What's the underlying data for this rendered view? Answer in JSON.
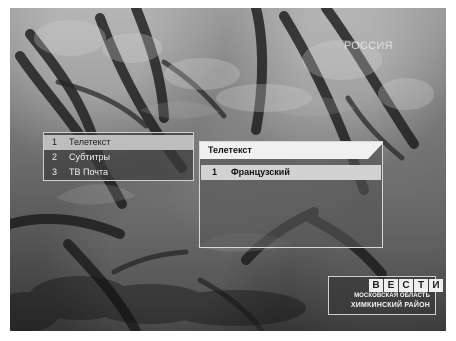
{
  "screen": {
    "watermark": "РОССИЯ"
  },
  "left_menu": {
    "items": [
      {
        "number": "1",
        "label": "Телетекст"
      },
      {
        "number": "2",
        "label": "Субтитры"
      },
      {
        "number": "3",
        "label": "ТВ Почта"
      }
    ]
  },
  "right_menu": {
    "title": "Телетекст",
    "items": [
      {
        "number": "1",
        "label": "Французский"
      }
    ]
  },
  "channel_badge": {
    "brand_letters": [
      "В",
      "Е",
      "С",
      "Т",
      "И"
    ],
    "region": "МОСКОВСКАЯ ОБЛАСТЬ",
    "district": "ХИМКИНСКИЙ РАЙОН"
  }
}
